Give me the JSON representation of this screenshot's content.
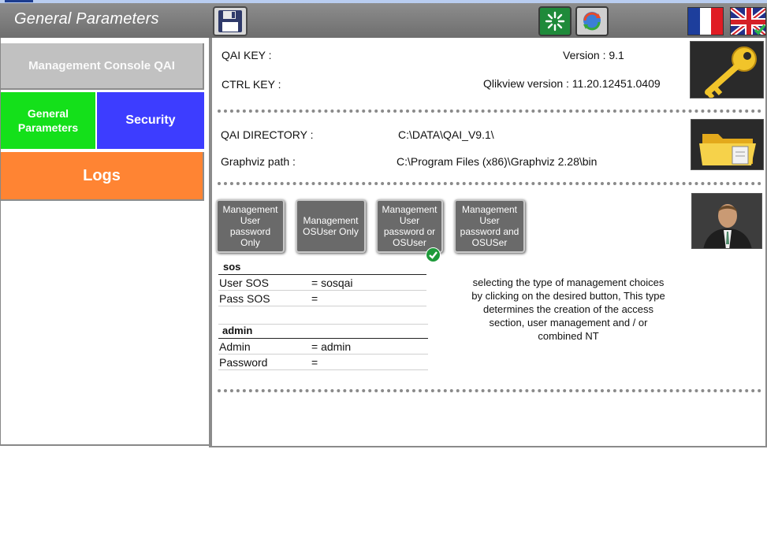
{
  "window": {
    "title": "General Parameters"
  },
  "toolbar": {
    "save_icon": "floppy-disk-icon",
    "reload_icon": "reload-spinner-icon",
    "sync_icon": "refresh-sync-icon",
    "languages": [
      "french-flag-icon",
      "uk-flag-icon"
    ],
    "selected_language": "uk"
  },
  "sidebar": {
    "console_label": "Management Console QAI",
    "general_label": "General Parameters",
    "security_label": "Security",
    "logs_label": "Logs"
  },
  "info": {
    "qai_key_label": "QAI KEY :",
    "ctrl_key_label": "CTRL KEY :",
    "version_text": "Version : 9.1",
    "qlikview_version_text": "Qlikview version : 11.20.12451.0409",
    "qai_directory_label": "QAI DIRECTORY :",
    "qai_directory_value": "C:\\DATA\\QAI_V9.1\\",
    "graphviz_label": "Graphviz path :",
    "graphviz_value": "C:\\Program Files (x86)\\Graphviz 2.28\\bin"
  },
  "modes": [
    {
      "label": "Management User password Only",
      "selected": false
    },
    {
      "label": "Management OSUser Only",
      "selected": false
    },
    {
      "label": "Management User password or OSUser",
      "selected": true
    },
    {
      "label": "Management User password and OSUSer",
      "selected": false
    }
  ],
  "sos": {
    "title": "sos",
    "user_label": "User SOS",
    "user_value": "= sosqai",
    "pass_label": "Pass SOS",
    "pass_value": "="
  },
  "admin": {
    "title": "admin",
    "admin_label": "Admin",
    "admin_value": "= admin",
    "password_label": "Password",
    "password_value": "="
  },
  "description": "selecting the type of management choices by clicking on the desired button, This type determines the creation of the access section, user management and / or combined NT",
  "colors": {
    "console": "#c1c1c1",
    "general": "#14e01a",
    "security": "#3d3dff",
    "logs": "#ff8433",
    "titlebar": "#7a7a7a"
  }
}
